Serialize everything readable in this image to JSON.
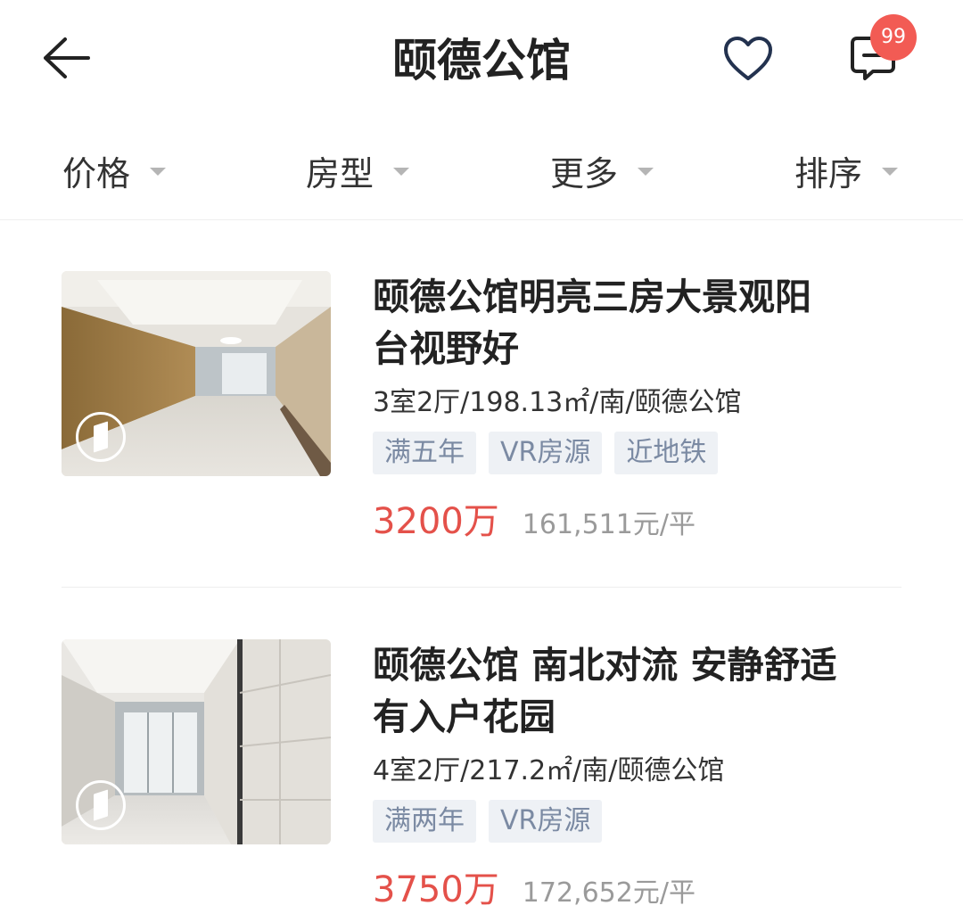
{
  "header": {
    "title": "颐德公馆",
    "badge_count": "99"
  },
  "filters": [
    {
      "label": "价格"
    },
    {
      "label": "房型"
    },
    {
      "label": "更多"
    },
    {
      "label": "排序"
    }
  ],
  "listings": [
    {
      "title_line1": "颐德公馆明亮三房大景观阳",
      "title_line2": "台视野好",
      "meta": "3室2厅/198.13㎡/南/颐德公馆",
      "tags": [
        "满五年",
        "VR房源",
        "近地铁"
      ],
      "price": "3200万",
      "unit_price": "161,511元/平"
    },
    {
      "title_line1": "颐德公馆 南北对流 安静舒适",
      "title_line2": "有入户花园",
      "meta": "4室2厅/217.2㎡/南/颐德公馆",
      "tags": [
        "满两年",
        "VR房源"
      ],
      "price": "3750万",
      "unit_price": "172,652元/平"
    }
  ],
  "colors": {
    "accent_price": "#e4514a",
    "badge": "#f25b54",
    "tag_bg": "#eef1f5",
    "tag_text": "#7b8aa3"
  },
  "icons": {
    "back": "arrow-left-icon",
    "favorite": "heart-icon",
    "messages": "chat-minus-icon",
    "vr": "vr-door-icon"
  }
}
